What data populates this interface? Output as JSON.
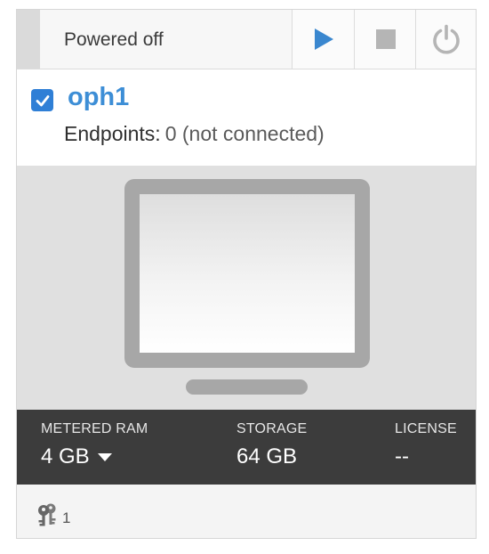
{
  "toolbar": {
    "status": "Powered off",
    "icons": {
      "play": "play-icon",
      "stop": "stop-icon",
      "power": "power-icon"
    },
    "colors": {
      "play": "#3a87cf",
      "stop": "#b5b5b5",
      "power": "#b5b5b5"
    }
  },
  "vm": {
    "name": "oph1",
    "checked": true,
    "endpoints_label": "Endpoints:",
    "endpoints_value": "0 (not connected)"
  },
  "stats": {
    "ram_label": "METERED RAM",
    "ram_value": "4 GB",
    "storage_label": "STORAGE",
    "storage_value": "64 GB",
    "license_label": "LICENSE",
    "license_value": "--"
  },
  "footer": {
    "keys_icon": "keys-icon",
    "keys_count": "1"
  },
  "colors": {
    "accent": "#3d8ed6",
    "checkbox": "#2f7fd6",
    "stats_bg": "#3c3c3c"
  }
}
